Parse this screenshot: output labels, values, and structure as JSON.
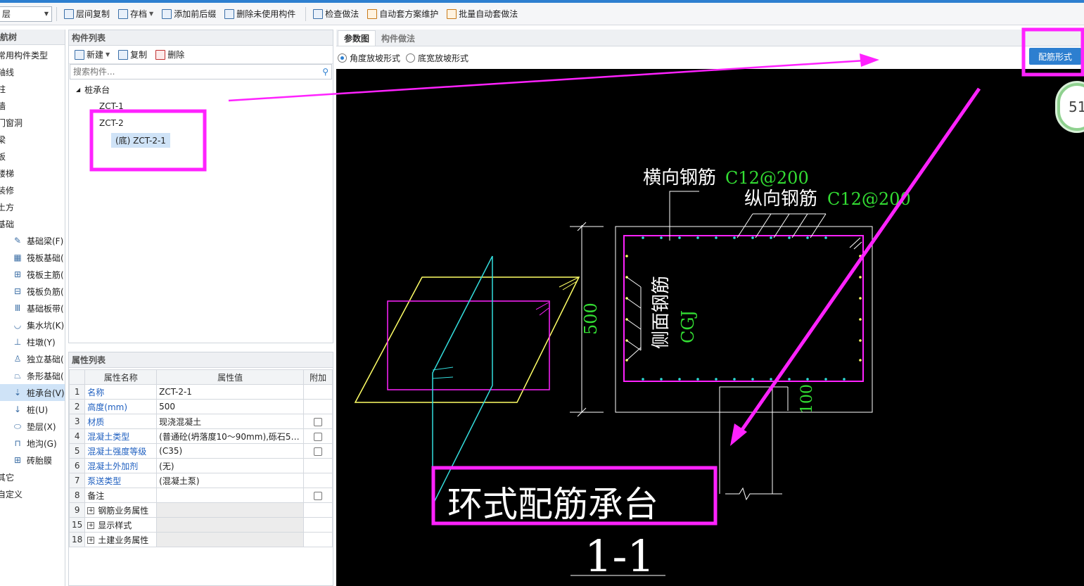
{
  "toolbar": {
    "floor_value": "层",
    "buttons": [
      "层间复制",
      "存档",
      "添加前后缀",
      "删除未使用构件",
      "检查做法",
      "自动套方案维护",
      "批量自动套做法"
    ]
  },
  "nav": {
    "header": "航树",
    "items": [
      "常用构件类型",
      "轴线",
      "柱",
      "墙",
      "门窗洞",
      "梁",
      "板",
      "楼梯",
      "装修",
      "土方",
      "基础"
    ],
    "sub_items": [
      "基础梁(F)",
      "筏板基础(",
      "筏板主筋(",
      "筏板负筋(",
      "基础板带(",
      "集水坑(K)",
      "柱墩(Y)",
      "独立基础(",
      "条形基础(",
      "桩承台(V)",
      "桩(U)",
      "垫层(X)",
      "地沟(G)",
      "砖胎膜"
    ],
    "tail_items": [
      "其它",
      "自定义"
    ]
  },
  "components": {
    "header": "构件列表",
    "new_label": "新建",
    "copy_label": "复制",
    "delete_label": "删除",
    "search_placeholder": "搜索构件...",
    "tree_root": "桩承台",
    "tree_items": [
      "ZCT-1",
      "ZCT-2"
    ],
    "tree_child": "(底) ZCT-2-1"
  },
  "properties": {
    "header": "属性列表",
    "col_name": "属性名称",
    "col_value": "属性值",
    "col_extra": "附加",
    "rows": [
      {
        "num": "1",
        "name": "名称",
        "value": "ZCT-2-1"
      },
      {
        "num": "2",
        "name": "高度(mm)",
        "value": "500"
      },
      {
        "num": "3",
        "name": "材质",
        "value": "现浇混凝土"
      },
      {
        "num": "4",
        "name": "混凝土类型",
        "value": "(普通砼(坍落度10～90mm),砾石5～..."
      },
      {
        "num": "5",
        "name": "混凝土强度等级",
        "value": "(C35)"
      },
      {
        "num": "6",
        "name": "混凝土外加剂",
        "value": "(无)"
      },
      {
        "num": "7",
        "name": "泵送类型",
        "value": "(混凝土泵)"
      },
      {
        "num": "8",
        "name": "备注",
        "value": ""
      },
      {
        "num": "9",
        "name": "钢筋业务属性",
        "value": ""
      },
      {
        "num": "15",
        "name": "显示样式",
        "value": ""
      },
      {
        "num": "18",
        "name": "土建业务属性",
        "value": ""
      }
    ]
  },
  "right": {
    "tab_params": "参数图",
    "tab_method": "构件做法",
    "radio_angle": "角度放坡形式",
    "radio_bottom": "底宽放坡形式",
    "rebar_button": "配筋形式",
    "badge": "51"
  },
  "drawing": {
    "transverse_label": "横向钢筋",
    "transverse_value": "C12@200",
    "longitudinal_label": "纵向钢筋",
    "longitudinal_value": "C12@200",
    "side_label": "侧面钢筋",
    "side_value": "CGJ",
    "height_dim": "500",
    "offset_dim": "100",
    "caption": "环式配筋承台",
    "section": "1-1"
  },
  "colors": {
    "accent": "#2d7fd0",
    "annotation": "#ff22ff",
    "rebar_green": "#33dd33",
    "cad_yellow": "#ffff66",
    "cad_cyan": "#33dddd"
  }
}
